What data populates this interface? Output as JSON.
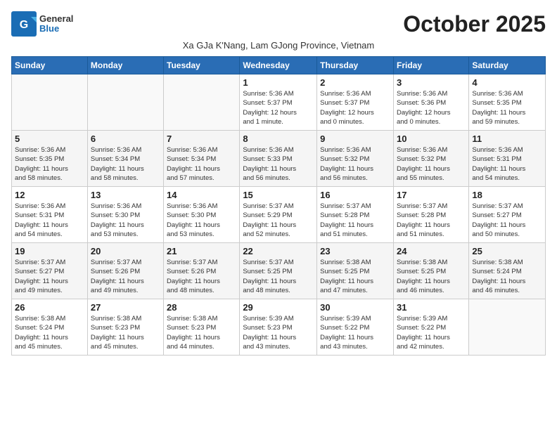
{
  "logo": {
    "general": "General",
    "blue": "Blue"
  },
  "title": "October 2025",
  "subtitle": "Xa GJa K'Nang, Lam GJong Province, Vietnam",
  "headers": [
    "Sunday",
    "Monday",
    "Tuesday",
    "Wednesday",
    "Thursday",
    "Friday",
    "Saturday"
  ],
  "weeks": [
    [
      {
        "day": "",
        "info": ""
      },
      {
        "day": "",
        "info": ""
      },
      {
        "day": "",
        "info": ""
      },
      {
        "day": "1",
        "info": "Sunrise: 5:36 AM\nSunset: 5:37 PM\nDaylight: 12 hours\nand 1 minute."
      },
      {
        "day": "2",
        "info": "Sunrise: 5:36 AM\nSunset: 5:37 PM\nDaylight: 12 hours\nand 0 minutes."
      },
      {
        "day": "3",
        "info": "Sunrise: 5:36 AM\nSunset: 5:36 PM\nDaylight: 12 hours\nand 0 minutes."
      },
      {
        "day": "4",
        "info": "Sunrise: 5:36 AM\nSunset: 5:35 PM\nDaylight: 11 hours\nand 59 minutes."
      }
    ],
    [
      {
        "day": "5",
        "info": "Sunrise: 5:36 AM\nSunset: 5:35 PM\nDaylight: 11 hours\nand 58 minutes."
      },
      {
        "day": "6",
        "info": "Sunrise: 5:36 AM\nSunset: 5:34 PM\nDaylight: 11 hours\nand 58 minutes."
      },
      {
        "day": "7",
        "info": "Sunrise: 5:36 AM\nSunset: 5:34 PM\nDaylight: 11 hours\nand 57 minutes."
      },
      {
        "day": "8",
        "info": "Sunrise: 5:36 AM\nSunset: 5:33 PM\nDaylight: 11 hours\nand 56 minutes."
      },
      {
        "day": "9",
        "info": "Sunrise: 5:36 AM\nSunset: 5:32 PM\nDaylight: 11 hours\nand 56 minutes."
      },
      {
        "day": "10",
        "info": "Sunrise: 5:36 AM\nSunset: 5:32 PM\nDaylight: 11 hours\nand 55 minutes."
      },
      {
        "day": "11",
        "info": "Sunrise: 5:36 AM\nSunset: 5:31 PM\nDaylight: 11 hours\nand 54 minutes."
      }
    ],
    [
      {
        "day": "12",
        "info": "Sunrise: 5:36 AM\nSunset: 5:31 PM\nDaylight: 11 hours\nand 54 minutes."
      },
      {
        "day": "13",
        "info": "Sunrise: 5:36 AM\nSunset: 5:30 PM\nDaylight: 11 hours\nand 53 minutes."
      },
      {
        "day": "14",
        "info": "Sunrise: 5:36 AM\nSunset: 5:30 PM\nDaylight: 11 hours\nand 53 minutes."
      },
      {
        "day": "15",
        "info": "Sunrise: 5:37 AM\nSunset: 5:29 PM\nDaylight: 11 hours\nand 52 minutes."
      },
      {
        "day": "16",
        "info": "Sunrise: 5:37 AM\nSunset: 5:28 PM\nDaylight: 11 hours\nand 51 minutes."
      },
      {
        "day": "17",
        "info": "Sunrise: 5:37 AM\nSunset: 5:28 PM\nDaylight: 11 hours\nand 51 minutes."
      },
      {
        "day": "18",
        "info": "Sunrise: 5:37 AM\nSunset: 5:27 PM\nDaylight: 11 hours\nand 50 minutes."
      }
    ],
    [
      {
        "day": "19",
        "info": "Sunrise: 5:37 AM\nSunset: 5:27 PM\nDaylight: 11 hours\nand 49 minutes."
      },
      {
        "day": "20",
        "info": "Sunrise: 5:37 AM\nSunset: 5:26 PM\nDaylight: 11 hours\nand 49 minutes."
      },
      {
        "day": "21",
        "info": "Sunrise: 5:37 AM\nSunset: 5:26 PM\nDaylight: 11 hours\nand 48 minutes."
      },
      {
        "day": "22",
        "info": "Sunrise: 5:37 AM\nSunset: 5:25 PM\nDaylight: 11 hours\nand 48 minutes."
      },
      {
        "day": "23",
        "info": "Sunrise: 5:38 AM\nSunset: 5:25 PM\nDaylight: 11 hours\nand 47 minutes."
      },
      {
        "day": "24",
        "info": "Sunrise: 5:38 AM\nSunset: 5:25 PM\nDaylight: 11 hours\nand 46 minutes."
      },
      {
        "day": "25",
        "info": "Sunrise: 5:38 AM\nSunset: 5:24 PM\nDaylight: 11 hours\nand 46 minutes."
      }
    ],
    [
      {
        "day": "26",
        "info": "Sunrise: 5:38 AM\nSunset: 5:24 PM\nDaylight: 11 hours\nand 45 minutes."
      },
      {
        "day": "27",
        "info": "Sunrise: 5:38 AM\nSunset: 5:23 PM\nDaylight: 11 hours\nand 45 minutes."
      },
      {
        "day": "28",
        "info": "Sunrise: 5:38 AM\nSunset: 5:23 PM\nDaylight: 11 hours\nand 44 minutes."
      },
      {
        "day": "29",
        "info": "Sunrise: 5:39 AM\nSunset: 5:23 PM\nDaylight: 11 hours\nand 43 minutes."
      },
      {
        "day": "30",
        "info": "Sunrise: 5:39 AM\nSunset: 5:22 PM\nDaylight: 11 hours\nand 43 minutes."
      },
      {
        "day": "31",
        "info": "Sunrise: 5:39 AM\nSunset: 5:22 PM\nDaylight: 11 hours\nand 42 minutes."
      },
      {
        "day": "",
        "info": ""
      }
    ]
  ]
}
